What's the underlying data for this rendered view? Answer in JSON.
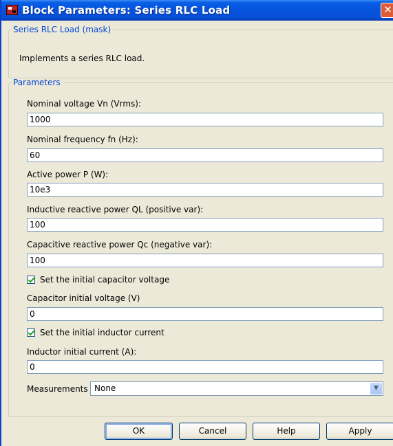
{
  "window": {
    "title": "Block Parameters: Series RLC Load",
    "close_glyph": "✕"
  },
  "mask_group": {
    "legend": "Series RLC Load (mask)",
    "description": "Implements a series RLC load."
  },
  "params_group": {
    "legend": "Parameters",
    "fields": [
      {
        "label": "Nominal voltage Vn (Vrms):",
        "value": "1000"
      },
      {
        "label": "Nominal frequency fn (Hz):",
        "value": "60"
      },
      {
        "label": "Active power P (W):",
        "value": "10e3"
      },
      {
        "label": "Inductive reactive power QL (positive var):",
        "value": "100"
      },
      {
        "label": "Capacitive reactive power Qc (negative var):",
        "value": "100"
      }
    ],
    "checkbox_capacitor": {
      "label": "Set the initial capacitor voltage",
      "checked": true
    },
    "capacitor_voltage": {
      "label": "Capacitor initial voltage (V)",
      "value": "0"
    },
    "checkbox_inductor": {
      "label": "Set the initial inductor current",
      "checked": true
    },
    "inductor_current": {
      "label": "Inductor initial current (A):",
      "value": "0"
    },
    "measurements": {
      "label": "Measurements",
      "selected": "None"
    }
  },
  "buttons": {
    "ok": "OK",
    "cancel": "Cancel",
    "help": "Help",
    "apply": "Apply"
  },
  "colors": {
    "titlebar": "#0553dd",
    "group_legend": "#0046d5",
    "dialog_bg": "#ece9d8",
    "close_button": "#e05a35"
  },
  "icons": {
    "app": "simulink-block-icon",
    "close": "close-icon",
    "dropdown": "chevron-down-icon",
    "check": "checkmark-icon"
  }
}
